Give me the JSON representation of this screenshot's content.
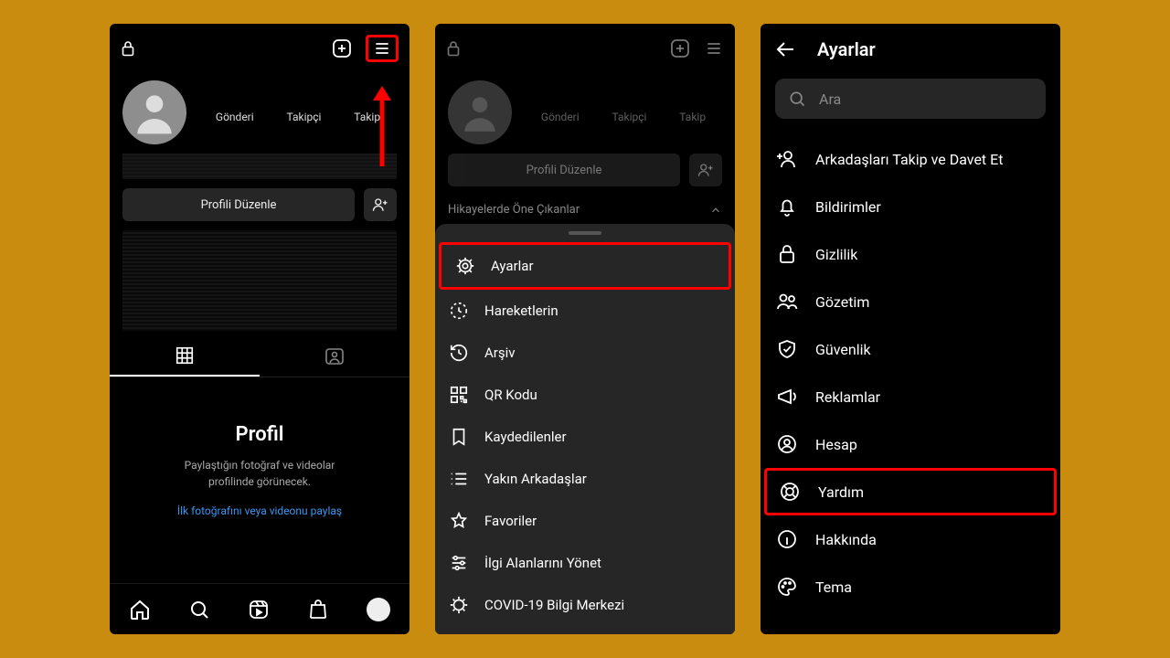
{
  "screen1": {
    "stats": {
      "posts": "Gönderi",
      "followers": "Takipçi",
      "following": "Takip"
    },
    "edit_profile": "Profili Düzenle",
    "tabs": {
      "grid": "grid-tab",
      "tagged": "tagged-tab"
    },
    "empty": {
      "title": "Profil",
      "desc1": "Paylaştığın fotoğraf ve videolar",
      "desc2": "profilinde görünecek.",
      "link": "İlk fotoğrafını veya videonu paylaş"
    }
  },
  "screen2": {
    "stats": {
      "posts": "Gönderi",
      "followers": "Takipçi",
      "following": "Takip"
    },
    "edit_profile": "Profili Düzenle",
    "highlights": "Hikayelerde Öne Çıkanlar",
    "menu": [
      {
        "key": "settings",
        "label": "Ayarlar"
      },
      {
        "key": "activity",
        "label": "Hareketlerin"
      },
      {
        "key": "archive",
        "label": "Arşiv"
      },
      {
        "key": "qr",
        "label": "QR Kodu"
      },
      {
        "key": "saved",
        "label": "Kaydedilenler"
      },
      {
        "key": "close",
        "label": "Yakın Arkadaşlar"
      },
      {
        "key": "favorites",
        "label": "Favoriler"
      },
      {
        "key": "interests",
        "label": "İlgi Alanlarını Yönet"
      },
      {
        "key": "covid",
        "label": "COVID-19 Bilgi Merkezi"
      }
    ]
  },
  "screen3": {
    "title": "Ayarlar",
    "search_placeholder": "Ara",
    "items": [
      {
        "key": "invite",
        "label": "Arkadaşları Takip ve Davet Et"
      },
      {
        "key": "notif",
        "label": "Bildirimler"
      },
      {
        "key": "privacy",
        "label": "Gizlilik"
      },
      {
        "key": "supervise",
        "label": "Gözetim"
      },
      {
        "key": "security",
        "label": "Güvenlik"
      },
      {
        "key": "ads",
        "label": "Reklamlar"
      },
      {
        "key": "account",
        "label": "Hesap"
      },
      {
        "key": "help",
        "label": "Yardım"
      },
      {
        "key": "about",
        "label": "Hakkında"
      },
      {
        "key": "theme",
        "label": "Tema"
      }
    ]
  }
}
